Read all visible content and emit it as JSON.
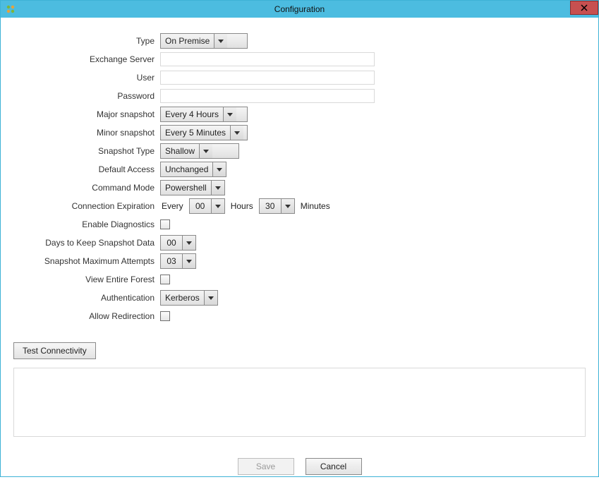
{
  "window": {
    "title": "Configuration"
  },
  "labels": {
    "type": "Type",
    "exchange_server": "Exchange Server",
    "user": "User",
    "password": "Password",
    "major_snapshot": "Major snapshot",
    "minor_snapshot": "Minor snapshot",
    "snapshot_type": "Snapshot Type",
    "default_access": "Default Access",
    "command_mode": "Command Mode",
    "connection_expiration": "Connection Expiration",
    "enable_diagnostics": "Enable Diagnostics",
    "days_to_keep": "Days to Keep Snapshot Data",
    "max_attempts": "Snapshot Maximum Attempts",
    "view_forest": "View Entire Forest",
    "authentication": "Authentication",
    "allow_redirection": "Allow Redirection",
    "every": "Every",
    "hours": "Hours",
    "minutes": "Minutes"
  },
  "values": {
    "type": "On Premise",
    "exchange_server": "",
    "user": "",
    "password": "",
    "major_snapshot": "Every 4 Hours",
    "minor_snapshot": "Every 5 Minutes",
    "snapshot_type": "Shallow",
    "default_access": "Unchanged",
    "command_mode": "Powershell",
    "exp_hours": "00",
    "exp_minutes": "30",
    "enable_diagnostics": false,
    "days_to_keep": "00",
    "max_attempts": "03",
    "view_forest": false,
    "authentication": "Kerberos",
    "allow_redirection": false
  },
  "buttons": {
    "test": "Test Connectivity",
    "save": "Save",
    "cancel": "Cancel"
  },
  "state": {
    "save_disabled": true
  },
  "colors": {
    "titlebar": "#4cbce0",
    "close": "#c75050"
  }
}
